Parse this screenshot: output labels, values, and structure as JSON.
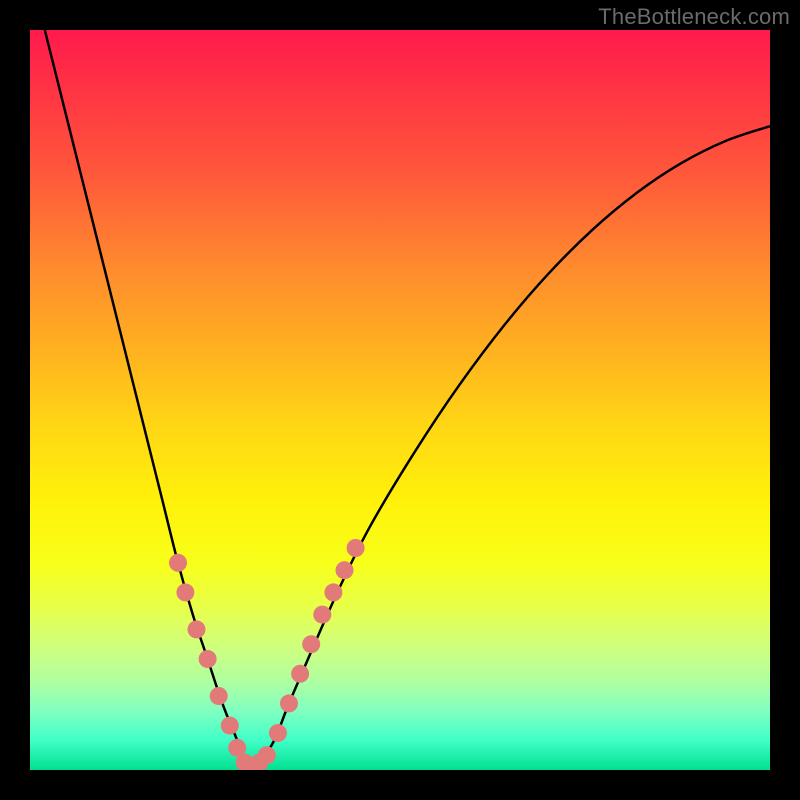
{
  "watermark": "TheBottleneck.com",
  "colors": {
    "background": "#000000",
    "curve": "#000000",
    "marker": "#e37a7a",
    "gradient_top": "#ff1a4d",
    "gradient_bottom": "#00e090"
  },
  "chart_data": {
    "type": "line",
    "title": "",
    "xlabel": "",
    "ylabel": "",
    "xlim": [
      0,
      100
    ],
    "ylim": [
      0,
      100
    ],
    "grid": false,
    "legend": false,
    "series": [
      {
        "name": "v-curve",
        "x": [
          2,
          4,
          6,
          8,
          10,
          12,
          14,
          16,
          18,
          20,
          22,
          24,
          26,
          28,
          29,
          30,
          31,
          33,
          35,
          38,
          42,
          46,
          52,
          58,
          64,
          70,
          76,
          82,
          88,
          94,
          100
        ],
        "y": [
          100,
          92,
          84,
          76,
          68,
          60,
          52,
          44,
          36,
          28,
          21,
          15,
          9,
          4,
          1,
          0,
          1,
          4,
          9,
          16,
          25,
          33,
          43,
          52,
          60,
          67,
          73,
          78,
          82,
          85,
          87
        ]
      }
    ],
    "markers": [
      {
        "x": 20.0,
        "y": 28
      },
      {
        "x": 21.0,
        "y": 24
      },
      {
        "x": 22.5,
        "y": 19
      },
      {
        "x": 24.0,
        "y": 15
      },
      {
        "x": 25.5,
        "y": 10
      },
      {
        "x": 27.0,
        "y": 6
      },
      {
        "x": 28.0,
        "y": 3
      },
      {
        "x": 29.0,
        "y": 1
      },
      {
        "x": 30.0,
        "y": 0
      },
      {
        "x": 31.0,
        "y": 1
      },
      {
        "x": 32.0,
        "y": 2
      },
      {
        "x": 33.5,
        "y": 5
      },
      {
        "x": 35.0,
        "y": 9
      },
      {
        "x": 36.5,
        "y": 13
      },
      {
        "x": 38.0,
        "y": 17
      },
      {
        "x": 39.5,
        "y": 21
      },
      {
        "x": 41.0,
        "y": 24
      },
      {
        "x": 42.5,
        "y": 27
      },
      {
        "x": 44.0,
        "y": 30
      }
    ]
  }
}
